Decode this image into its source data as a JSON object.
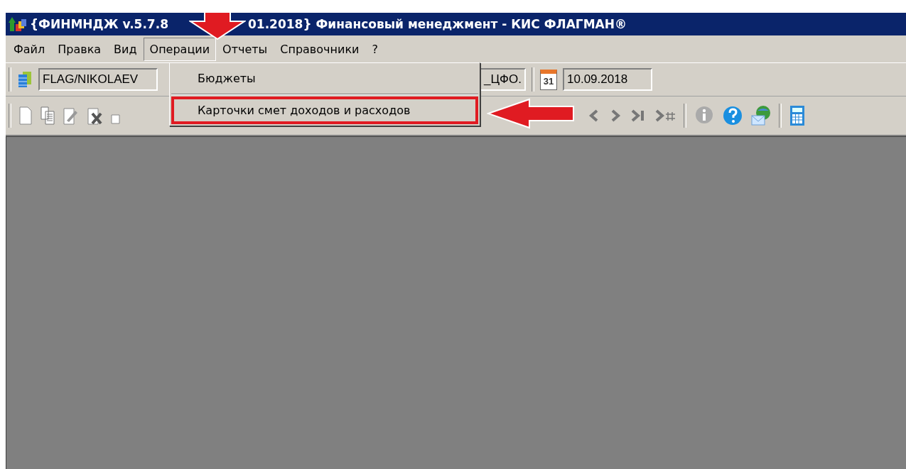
{
  "window": {
    "title_parts": [
      "{ФИНМНДЖ v.5.7.8",
      "01.2018} Финансовый менеджмент - КИС ФЛАГМАН®"
    ]
  },
  "menu": [
    {
      "label": "Файл",
      "selected": false
    },
    {
      "label": "Правка",
      "selected": false
    },
    {
      "label": "Вид",
      "selected": false
    },
    {
      "label": "Операции",
      "selected": true
    },
    {
      "label": "Отчеты",
      "selected": false
    },
    {
      "label": "Справочники",
      "selected": false
    },
    {
      "label": "?",
      "selected": false
    }
  ],
  "toolbar": {
    "database_field": "FLAG/NIKOLAEV",
    "unit_field": "_ЦФО.",
    "calendar_day": "31",
    "date_field": "10.09.2018"
  },
  "dropdown": [
    {
      "label": "Бюджеты",
      "highlighted": false
    },
    {
      "label": "Карточки смет доходов и расходов",
      "highlighted": true
    }
  ]
}
